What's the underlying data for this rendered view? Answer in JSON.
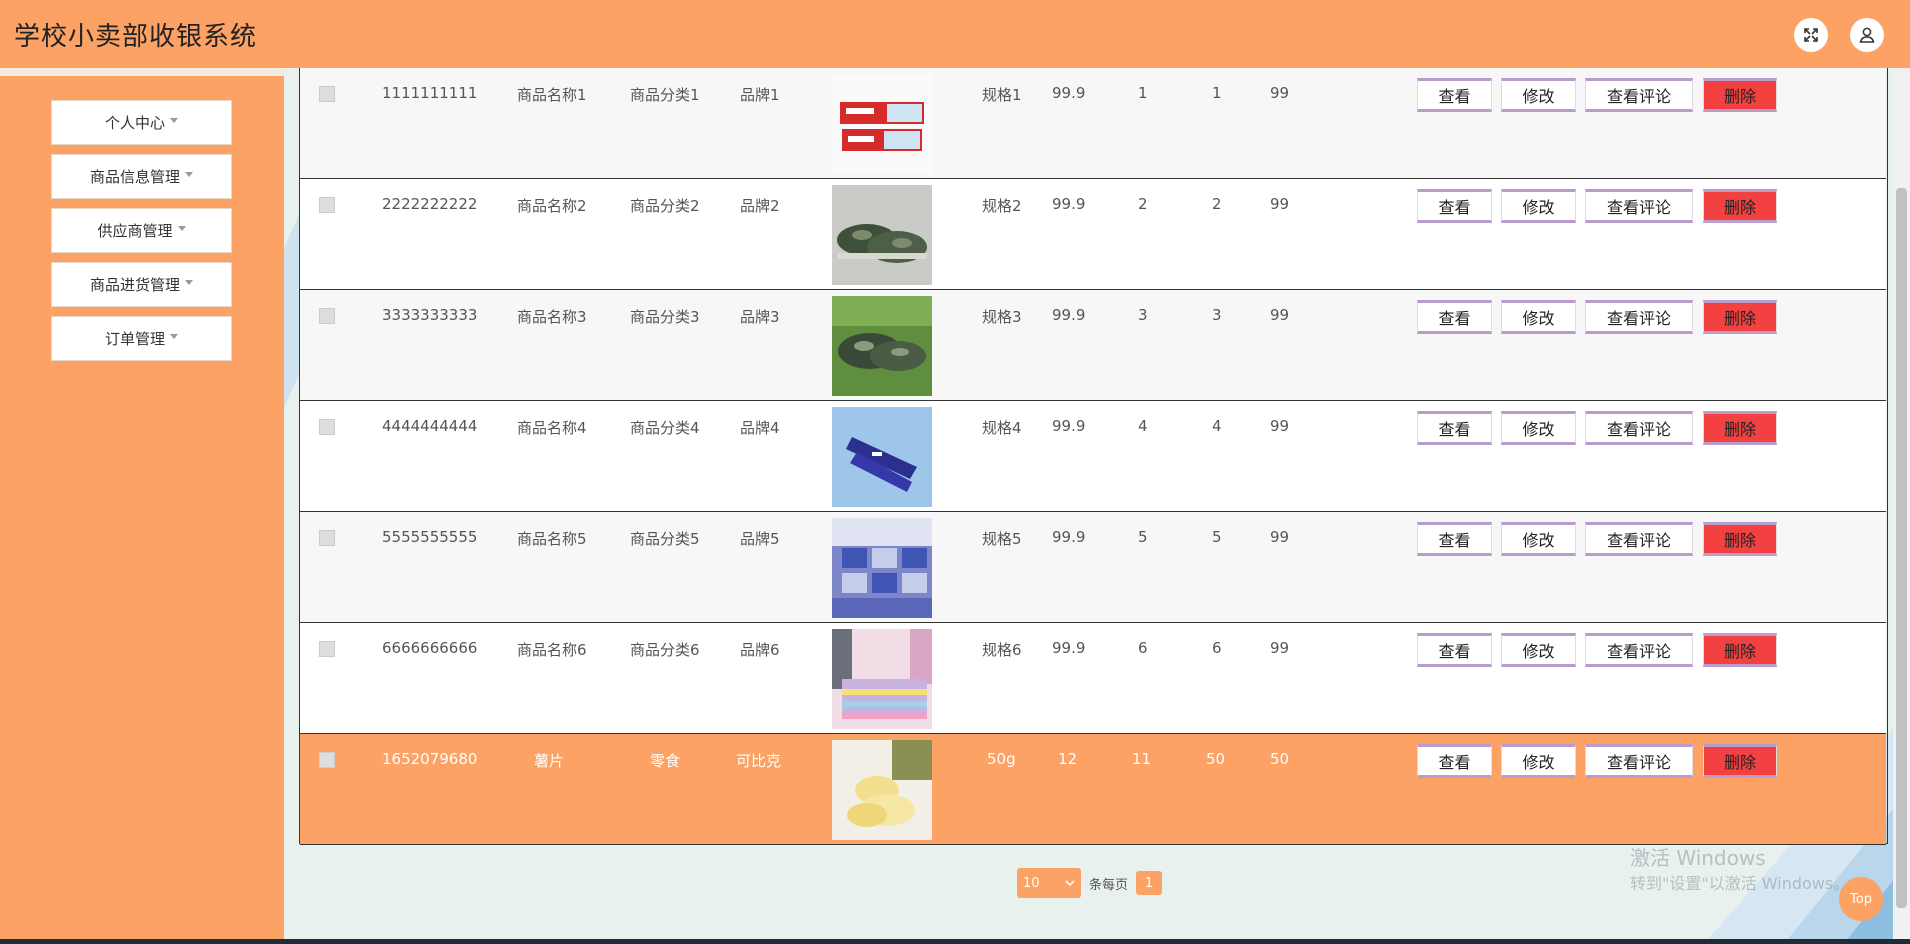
{
  "app": {
    "title": "学校小卖部收银系统"
  },
  "header_icons": [
    "fullscreen-icon",
    "user-icon"
  ],
  "sidebar": {
    "items": [
      {
        "label": "个人中心"
      },
      {
        "label": "商品信息管理"
      },
      {
        "label": "供应商管理"
      },
      {
        "label": "商品进货管理"
      },
      {
        "label": "订单管理"
      }
    ]
  },
  "table": {
    "rows": [
      {
        "code": "1111111111",
        "name": "商品名称1",
        "category": "商品分类1",
        "brand": "品牌1",
        "image": "toothpaste-box",
        "spec": "规格1",
        "price": "99.9",
        "c1": "1",
        "c2": "1",
        "c3": "99"
      },
      {
        "code": "2222222222",
        "name": "商品名称2",
        "category": "商品分类2",
        "brand": "品牌2",
        "image": "camo-shoes",
        "spec": "规格2",
        "price": "99.9",
        "c1": "2",
        "c2": "2",
        "c3": "99"
      },
      {
        "code": "3333333333",
        "name": "商品名称3",
        "category": "商品分类3",
        "brand": "品牌3",
        "image": "camo-shoes",
        "spec": "规格3",
        "price": "99.9",
        "c1": "3",
        "c2": "3",
        "c3": "99"
      },
      {
        "code": "4444444444",
        "name": "商品名称4",
        "category": "商品分类4",
        "brand": "品牌4",
        "image": "toothpaste-blue",
        "spec": "规格4",
        "price": "99.9",
        "c1": "4",
        "c2": "4",
        "c3": "99"
      },
      {
        "code": "5555555555",
        "name": "商品名称5",
        "category": "商品分类5",
        "brand": "品牌5",
        "image": "bedding-blue",
        "spec": "规格5",
        "price": "99.9",
        "c1": "5",
        "c2": "5",
        "c3": "99"
      },
      {
        "code": "6666666666",
        "name": "商品名称6",
        "category": "商品分类6",
        "brand": "品牌6",
        "image": "bedding-pastel",
        "spec": "规格6",
        "price": "99.9",
        "c1": "6",
        "c2": "6",
        "c3": "99"
      },
      {
        "code": "1652079680",
        "name": "薯片",
        "category": "零食",
        "brand": "可比克",
        "image": "potato-chips",
        "spec": "50g",
        "price": "12",
        "c1": "11",
        "c2": "50",
        "c3": "50"
      }
    ],
    "actions": {
      "view": "查看",
      "edit": "修改",
      "view_comments": "查看评论",
      "delete": "删除"
    }
  },
  "pagination": {
    "page_size": "10",
    "per_page_label": "条每页",
    "current_page": "1"
  },
  "top_button": "Top",
  "watermark": {
    "line1": "激活 Windows",
    "line2": "转到\"设置\"以激活 Windows。"
  },
  "colors": {
    "brand": "#fba264",
    "delete": "#f34040",
    "button_border": "#b99ccc"
  }
}
